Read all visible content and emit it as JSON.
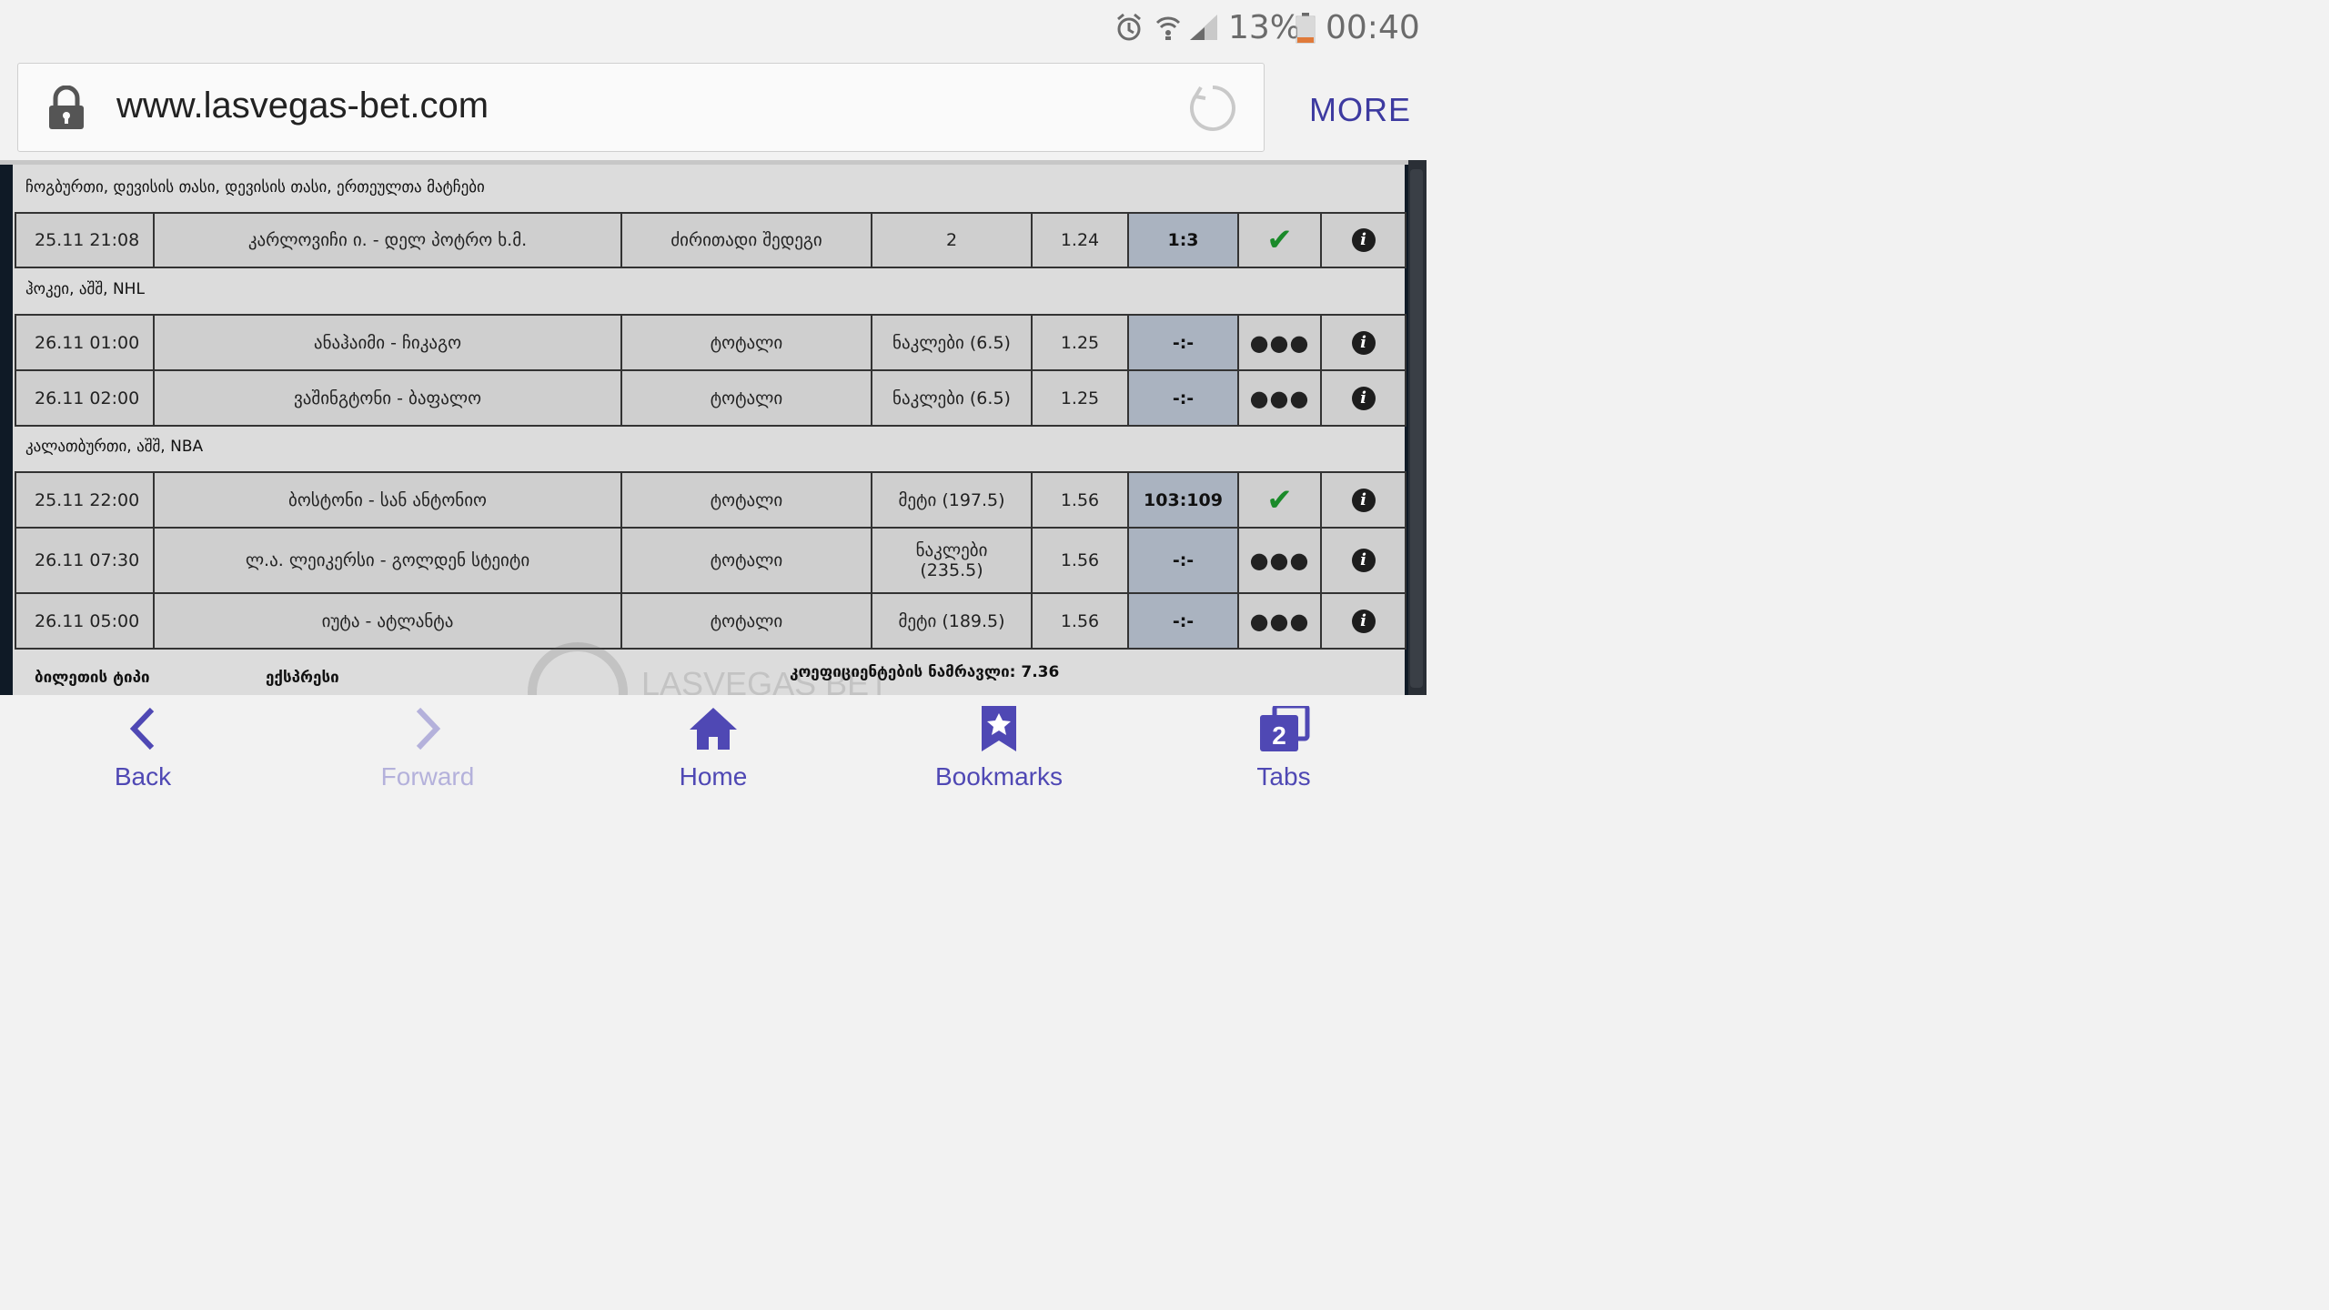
{
  "status_bar": {
    "battery": "13%",
    "time": "00:40",
    "icons": [
      "alarm-icon",
      "wifi-icon",
      "signal-icon",
      "battery-icon"
    ]
  },
  "browser": {
    "url": "www.lasvegas-bet.com",
    "more_label": "MORE"
  },
  "groups": [
    {
      "title": "ჩოგბურთი, დევისის თასი, დევისის თასი, ერთეულთა მატჩები",
      "rows": [
        {
          "date": "25.11 21:08",
          "match": "კარლოვიჩი ი. - დელ პოტრო ხ.მ.",
          "market": "ძირითადი შედეგი",
          "pick": "2",
          "odds": "1.24",
          "score": "1:3",
          "status": "won"
        }
      ]
    },
    {
      "title": "ჰოკეი, აშშ, NHL",
      "rows": [
        {
          "date": "26.11 01:00",
          "match": "ანაჰაიმი - ჩიკაგო",
          "market": "ტოტალი",
          "pick": "ნაკლები (6.5)",
          "odds": "1.25",
          "score": "-:-",
          "status": "pending"
        },
        {
          "date": "26.11 02:00",
          "match": "ვაშინგტონი - ბაფალო",
          "market": "ტოტალი",
          "pick": "ნაკლები (6.5)",
          "odds": "1.25",
          "score": "-:-",
          "status": "pending"
        }
      ]
    },
    {
      "title": "კალათბურთი, აშშ, NBA",
      "rows": [
        {
          "date": "25.11 22:00",
          "match": "ბოსტონი - სან ანტონიო",
          "market": "ტოტალი",
          "pick": "მეტი (197.5)",
          "odds": "1.56",
          "score": "103:109",
          "status": "won"
        },
        {
          "date": "26.11 07:30",
          "match": "ლ.ა. ლეიკერსი - გოლდენ სტეიტი",
          "market": "ტოტალი",
          "pick": "ნაკლები (235.5)",
          "odds": "1.56",
          "score": "-:-",
          "status": "pending"
        },
        {
          "date": "26.11 05:00",
          "match": "იუტა - ატლანტა",
          "market": "ტოტალი",
          "pick": "მეტი (189.5)",
          "odds": "1.56",
          "score": "-:-",
          "status": "pending"
        }
      ]
    }
  ],
  "footer": {
    "ticket_type_label": "ბილეთის ტიპი",
    "ticket_type_value": "ექსპრესი",
    "total_odds": "კოეფიციენტების ნამრავლი: 7.36",
    "watermark_text": "LASVEGAS BET"
  },
  "nav": {
    "back": "Back",
    "forward": "Forward",
    "home": "Home",
    "bookmarks": "Bookmarks",
    "tabs": "Tabs",
    "tabs_count": "2"
  },
  "colors": {
    "accent": "#4f48b4",
    "score_cell": "#aab3c0",
    "won_check": "#1b8a2a"
  }
}
